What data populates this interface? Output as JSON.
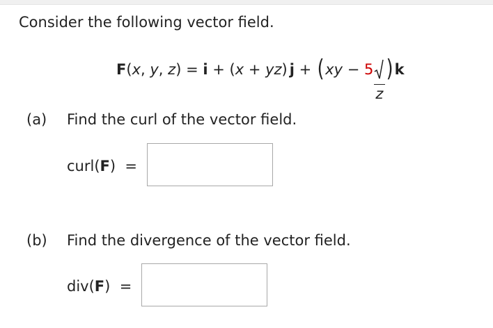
{
  "intro": "Consider the following vector field.",
  "formula": {
    "lhs_F": "F",
    "lhs_args_open": "(",
    "var_x": "x",
    "comma1": ", ",
    "var_y": "y",
    "comma2": ", ",
    "var_z": "z",
    "lhs_args_close": ")",
    "equals": " = ",
    "i": "i",
    "plus1": " + ",
    "paren_open": "(",
    "t2_x": "x",
    "t2_plus": " + ",
    "t2_yz": "yz",
    "paren_close": ")",
    "j": "j",
    "plus2": " + ",
    "big_open": "(",
    "t3_xy": "xy",
    "t3_minus": " − ",
    "t3_coef": "5",
    "t3_radicand": "z",
    "big_close": ")",
    "k": "k"
  },
  "part_a": {
    "label": "(a)",
    "text": "Find the curl of the vector field.",
    "answer_label_pre": "curl(",
    "answer_label_F": "F",
    "answer_label_post": ")  =",
    "answer_value": ""
  },
  "part_b": {
    "label": "(b)",
    "text": "Find the divergence of the vector field.",
    "answer_label_pre": "div(",
    "answer_label_F": "F",
    "answer_label_post": ")  =",
    "answer_value": ""
  },
  "colors": {
    "highlight": "#cc0000",
    "text": "#222222",
    "box_border": "#a8a8a8"
  }
}
